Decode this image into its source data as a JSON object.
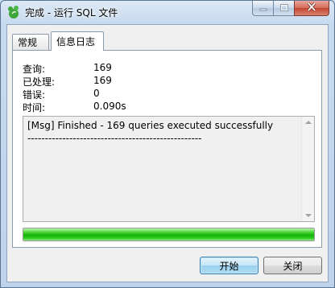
{
  "window": {
    "title": "完成 - 运行 SQL 文件",
    "icon": "navicat-leaf-icon"
  },
  "caption_buttons": {
    "minimize": "minimize-icon",
    "maximize": "maximize-icon",
    "close": "close-icon"
  },
  "tabs": [
    {
      "label": "常规",
      "active": false
    },
    {
      "label": "信息日志",
      "active": true
    }
  ],
  "stats": [
    {
      "label": "查询:",
      "value": "169"
    },
    {
      "label": "已处理:",
      "value": "169"
    },
    {
      "label": "错误:",
      "value": "0"
    },
    {
      "label": "时间:",
      "value": "0.090s"
    }
  ],
  "log": {
    "line1": "[Msg] Finished - 169 queries executed successfully",
    "line2": "--------------------------------------------------"
  },
  "progress": {
    "percent": 100,
    "color": "#16b30a"
  },
  "buttons": {
    "start": "开始",
    "close": "关闭"
  }
}
